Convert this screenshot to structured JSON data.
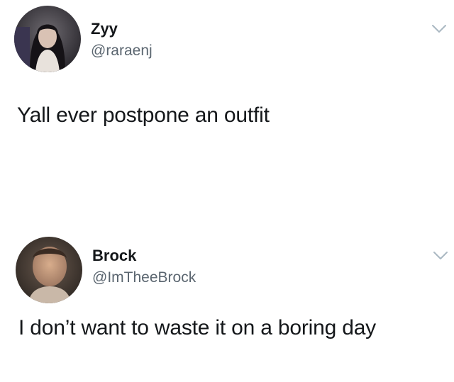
{
  "tweets": [
    {
      "display_name": "Zyy",
      "handle": "@raraenj",
      "text": "Yall ever postpone an outfit",
      "avatar_icon": "user-avatar-photo",
      "menu_icon": "chevron-down-icon"
    },
    {
      "display_name": "Brock",
      "handle": "@ImTheeBrock",
      "text": "I don’t want to waste it on a boring day",
      "avatar_icon": "user-avatar-photo",
      "menu_icon": "chevron-down-icon"
    }
  ],
  "colors": {
    "name": "#14171a",
    "handle": "#5b6670",
    "chevron": "#aab8c2",
    "background": "#ffffff"
  }
}
